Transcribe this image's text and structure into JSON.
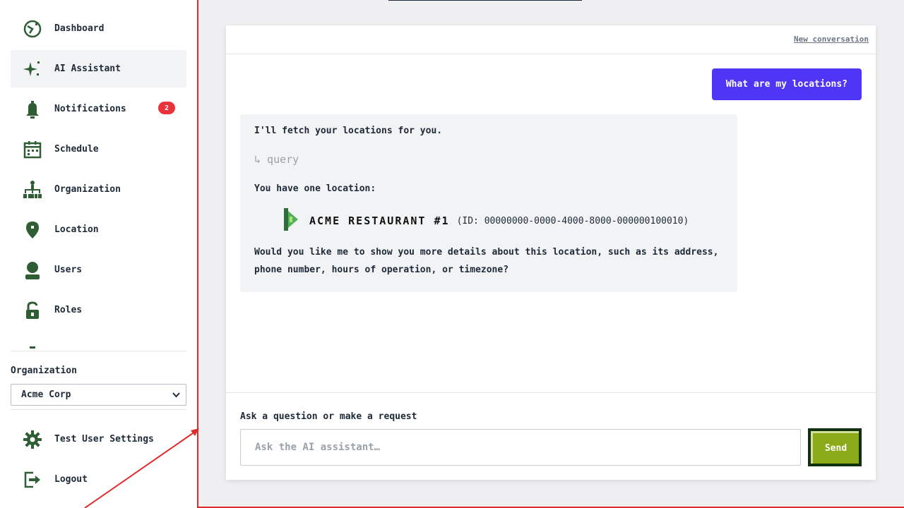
{
  "sidebar": {
    "items": [
      {
        "label": "Dashboard",
        "icon": "dashboard-icon"
      },
      {
        "label": "AI Assistant",
        "icon": "sparkle-icon"
      },
      {
        "label": "Notifications",
        "icon": "bell-icon",
        "badge": "2"
      },
      {
        "label": "Schedule",
        "icon": "calendar-icon"
      },
      {
        "label": "Organization",
        "icon": "org-chart-icon"
      },
      {
        "label": "Location",
        "icon": "map-pin-icon"
      },
      {
        "label": "Users",
        "icon": "user-icon"
      },
      {
        "label": "Roles",
        "icon": "unlock-icon"
      }
    ],
    "active_item": "AI Assistant",
    "organization_label": "Organization",
    "organization_value": "Acme Corp",
    "bottom_items": [
      {
        "label": "Test User Settings",
        "icon": "gear-icon"
      },
      {
        "label": "Logout",
        "icon": "logout-icon"
      }
    ]
  },
  "chat": {
    "new_conversation": "New conversation",
    "user_message": "What are my locations?",
    "assistant": {
      "intro": "I'll fetch your locations for you.",
      "tool_call": "↳ query",
      "summary": "You have one location:",
      "location_name": "ACME RESTAURANT #1",
      "location_id": "(ID: 00000000-0000-4000-8000-000000100010)",
      "question": "Would you like me to show you more details about this location, such as its address, phone number, hours of operation, or timezone?"
    },
    "input_label": "Ask a question or make a request",
    "input_placeholder": "Ask the AI assistant…",
    "send_label": "Send"
  },
  "colors": {
    "accent": "#4f35f6",
    "icon_green": "#2f5d34",
    "badge_red": "#e8323c",
    "frame_red": "#e02b2b",
    "send_green": "#8aaa18"
  }
}
